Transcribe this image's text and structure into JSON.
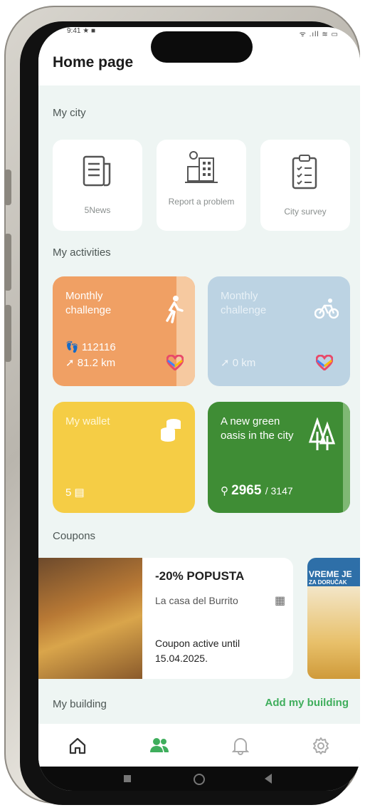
{
  "header": {
    "title": "Home page"
  },
  "status": {
    "left": "9:41 ★ ■",
    "right": "ᯤ .ıll ≋ ▭"
  },
  "sections": {
    "my_city": "My city",
    "my_activities": "My activities",
    "coupons": "Coupons",
    "my_building": "My building",
    "add_building": "Add my building"
  },
  "city_tiles": [
    {
      "label": "5News",
      "icon": "news-icon"
    },
    {
      "label": "Report a problem",
      "icon": "report-problem-icon"
    },
    {
      "label": "City survey",
      "icon": "survey-icon"
    }
  ],
  "activities": {
    "walk": {
      "title": "Monthly challenge",
      "steps": "112116",
      "distance": "81.2 km",
      "accent": "#f0a064"
    },
    "bike": {
      "title": "Monthly challenge",
      "distance": "0 km",
      "accent": "#bcd3e3"
    },
    "wallet": {
      "title": "My wallet",
      "amount": "5",
      "accent": "#f5cd45"
    },
    "green": {
      "title": "A new green oasis in the city",
      "current": "2965",
      "total": "/ 3147",
      "accent": "#3f8d35"
    }
  },
  "coupon": {
    "headline": "-20% POPUSTA",
    "vendor": "La casa del Burrito",
    "validity": "Coupon active until 15.04.2025.",
    "next_text_1": "VREME JE",
    "next_text_2": "ZA DORUČAK"
  },
  "nav": [
    {
      "icon": "home-icon"
    },
    {
      "icon": "people-icon"
    },
    {
      "icon": "bell-icon"
    },
    {
      "icon": "settings-icon"
    }
  ],
  "colors": {
    "accent_green": "#3fae5c",
    "background": "#eef5f3"
  }
}
